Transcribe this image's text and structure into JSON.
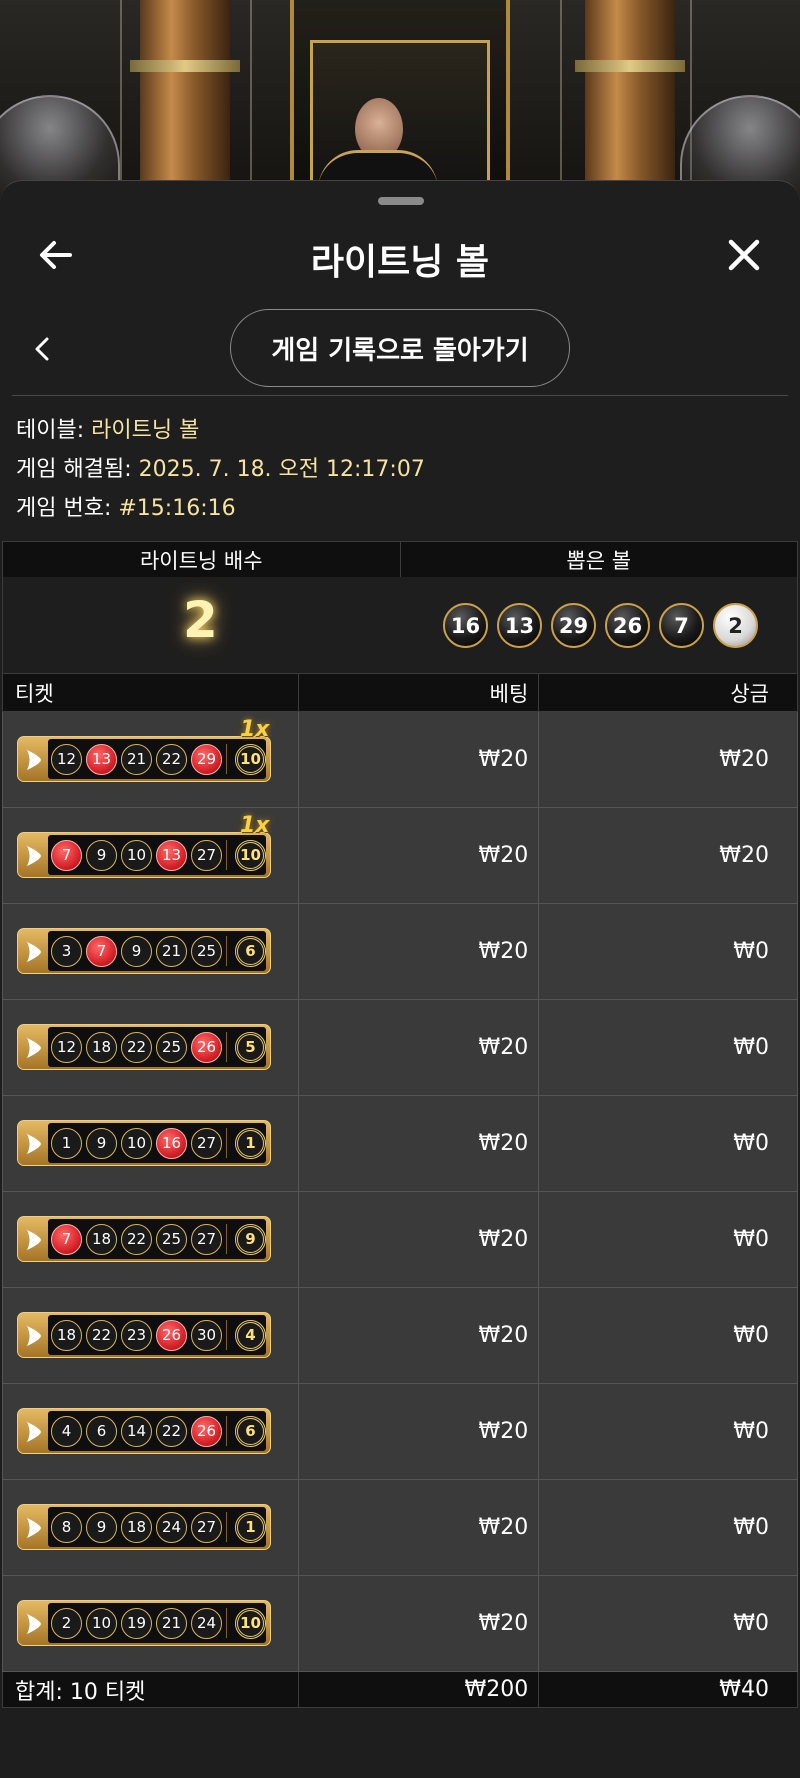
{
  "header": {
    "title": "라이트닝 볼"
  },
  "nav": {
    "back_to_history": "게임 기록으로 돌아가기"
  },
  "info": {
    "table_label": "테이블:",
    "table_value": "라이트닝 볼",
    "resolved_label": "게임 해결됨:",
    "resolved_value": "2025. 7. 18. 오전 12:17:07",
    "round_label": "게임 번호:",
    "round_value": "#15:16:16"
  },
  "summary": {
    "multiplier_header": "라이트닝 배수",
    "drawn_header": "뽑은 볼",
    "multiplier_value": "2",
    "drawn_balls": [
      "16",
      "13",
      "29",
      "26",
      "7",
      "2"
    ]
  },
  "tickets": {
    "headers": {
      "ticket": "티켓",
      "bet": "베팅",
      "win": "상금"
    },
    "rows": [
      {
        "balls": [
          "12",
          "13",
          "21",
          "22",
          "29"
        ],
        "bonus": "10",
        "multiplier": "1x",
        "bet": "₩20",
        "win": "₩20"
      },
      {
        "balls": [
          "7",
          "9",
          "10",
          "13",
          "27"
        ],
        "bonus": "10",
        "multiplier": "1x",
        "bet": "₩20",
        "win": "₩20"
      },
      {
        "balls": [
          "3",
          "7",
          "9",
          "21",
          "25"
        ],
        "bonus": "6",
        "bet": "₩20",
        "win": "₩0"
      },
      {
        "balls": [
          "12",
          "18",
          "22",
          "25",
          "26"
        ],
        "bonus": "5",
        "bet": "₩20",
        "win": "₩0"
      },
      {
        "balls": [
          "1",
          "9",
          "10",
          "16",
          "27"
        ],
        "bonus": "1",
        "bet": "₩20",
        "win": "₩0"
      },
      {
        "balls": [
          "7",
          "18",
          "22",
          "25",
          "27"
        ],
        "bonus": "9",
        "bet": "₩20",
        "win": "₩0"
      },
      {
        "balls": [
          "18",
          "22",
          "23",
          "26",
          "30"
        ],
        "bonus": "4",
        "bet": "₩20",
        "win": "₩0"
      },
      {
        "balls": [
          "4",
          "6",
          "14",
          "22",
          "26"
        ],
        "bonus": "6",
        "bet": "₩20",
        "win": "₩0"
      },
      {
        "balls": [
          "8",
          "9",
          "18",
          "24",
          "27"
        ],
        "bonus": "1",
        "bet": "₩20",
        "win": "₩0"
      },
      {
        "balls": [
          "2",
          "10",
          "19",
          "21",
          "24"
        ],
        "bonus": "10",
        "bet": "₩20",
        "win": "₩0"
      }
    ],
    "total": {
      "label": "합계: 10 티켓",
      "bet": "₩200",
      "win": "₩40"
    }
  },
  "colors": {
    "hit_ball": "#d8232a",
    "gold": "#d9b65d",
    "highlight_text": "#f4e3a1"
  },
  "icons": {
    "back": "arrow-left-icon",
    "close": "close-icon",
    "prev": "chevron-left-icon",
    "ticket": "play-triangle-icon"
  }
}
